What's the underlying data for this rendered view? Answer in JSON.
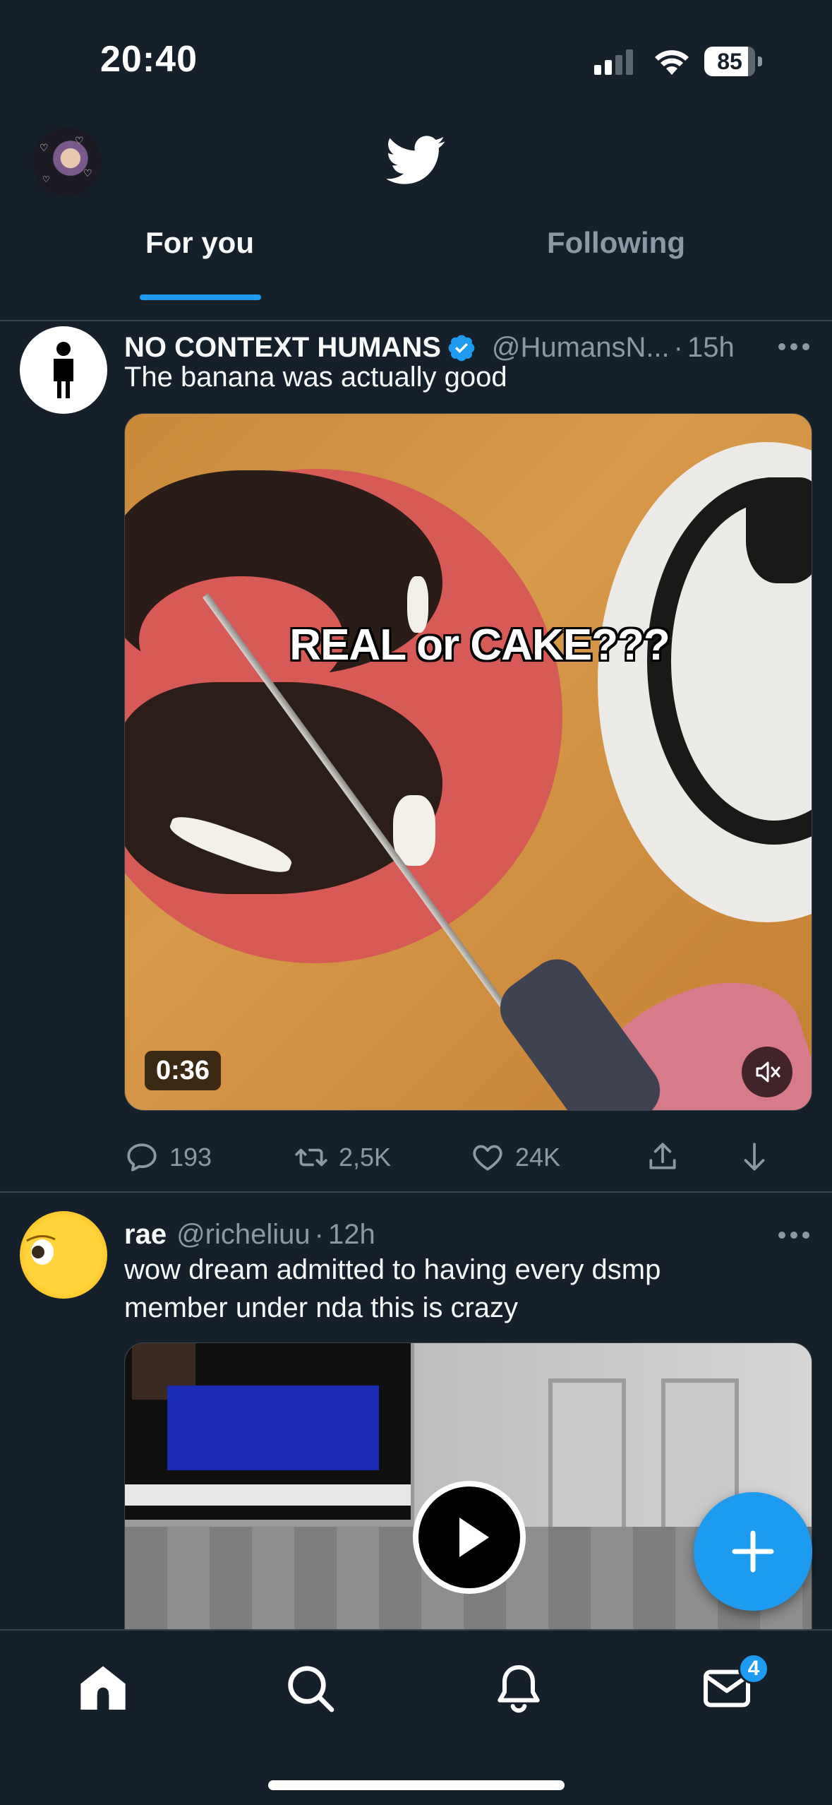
{
  "status_bar": {
    "time": "20:40",
    "battery": "85"
  },
  "header": {
    "tabs": [
      {
        "label": "For you",
        "active": true
      },
      {
        "label": "Following",
        "active": false
      }
    ]
  },
  "tweets": [
    {
      "name": "NO CONTEXT HUMANS",
      "verified": true,
      "handle": "@HumansN...",
      "time": "15h",
      "text": "The banana was actually good",
      "media": {
        "type": "video",
        "caption": "REAL or CAKE???",
        "duration": "0:36"
      },
      "stats": {
        "replies": "193",
        "retweets": "2,5K",
        "likes": "24K"
      }
    },
    {
      "name": "rae",
      "verified": false,
      "handle": "@richeliuu",
      "time": "12h",
      "text": "wow dream admitted to having every dsmp member under nda this is crazy",
      "media": {
        "type": "video"
      }
    }
  ],
  "bottom_nav": {
    "items": [
      "home-icon",
      "search-icon",
      "bell-icon",
      "mail-icon"
    ],
    "messages_badge": "4"
  },
  "colors": {
    "background": "#15202b",
    "accent": "#1d9bf0",
    "muted": "#8b98a5",
    "divider": "#38444d"
  }
}
